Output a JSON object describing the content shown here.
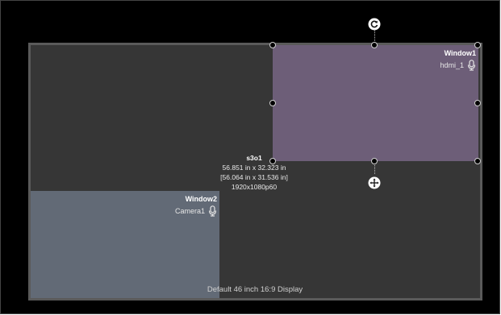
{
  "display": {
    "label": "Default 46 inch 16:9 Display",
    "background_color": "#363636",
    "border_color": "#5a5a5a"
  },
  "selection_info": {
    "name": "s3o1",
    "size": "56.851 in x 32.323 in",
    "bracket_size": "[56.064 in x 31.536 in]",
    "resolution": "1920x1080p60"
  },
  "windows": [
    {
      "title": "Window1",
      "source": "hdmi_1",
      "icon": "microphone-icon",
      "color": "#6d5e78"
    },
    {
      "title": "Window2",
      "source": "Camera1",
      "icon": "microphone-icon",
      "color": "#626a76"
    }
  ],
  "controls": {
    "rotate_icon": "rotate-icon",
    "move_icon": "move-icon"
  }
}
